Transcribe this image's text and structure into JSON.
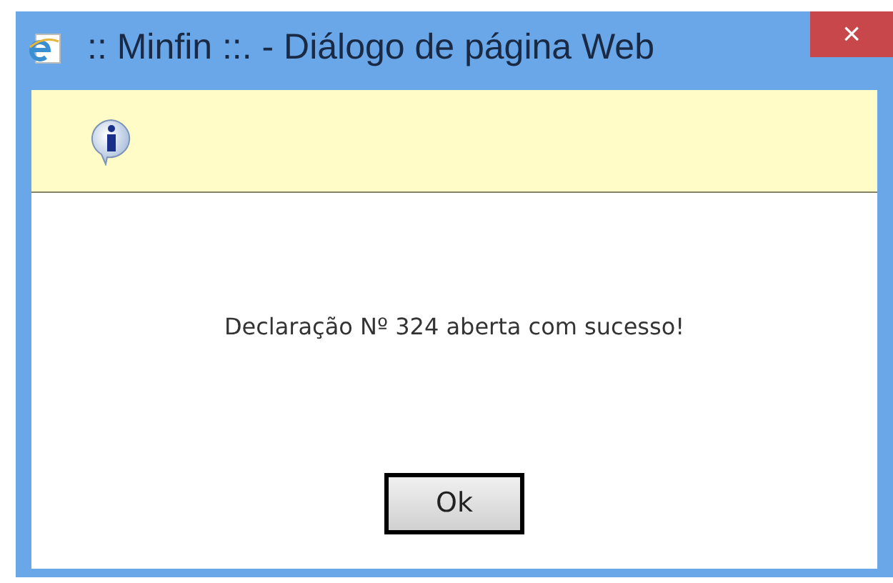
{
  "window": {
    "title": ":: Minfin ::. - Diálogo de página Web",
    "close": "×"
  },
  "message": "Declaração Nº 324 aberta com sucesso!",
  "buttons": [
    "Ok"
  ]
}
